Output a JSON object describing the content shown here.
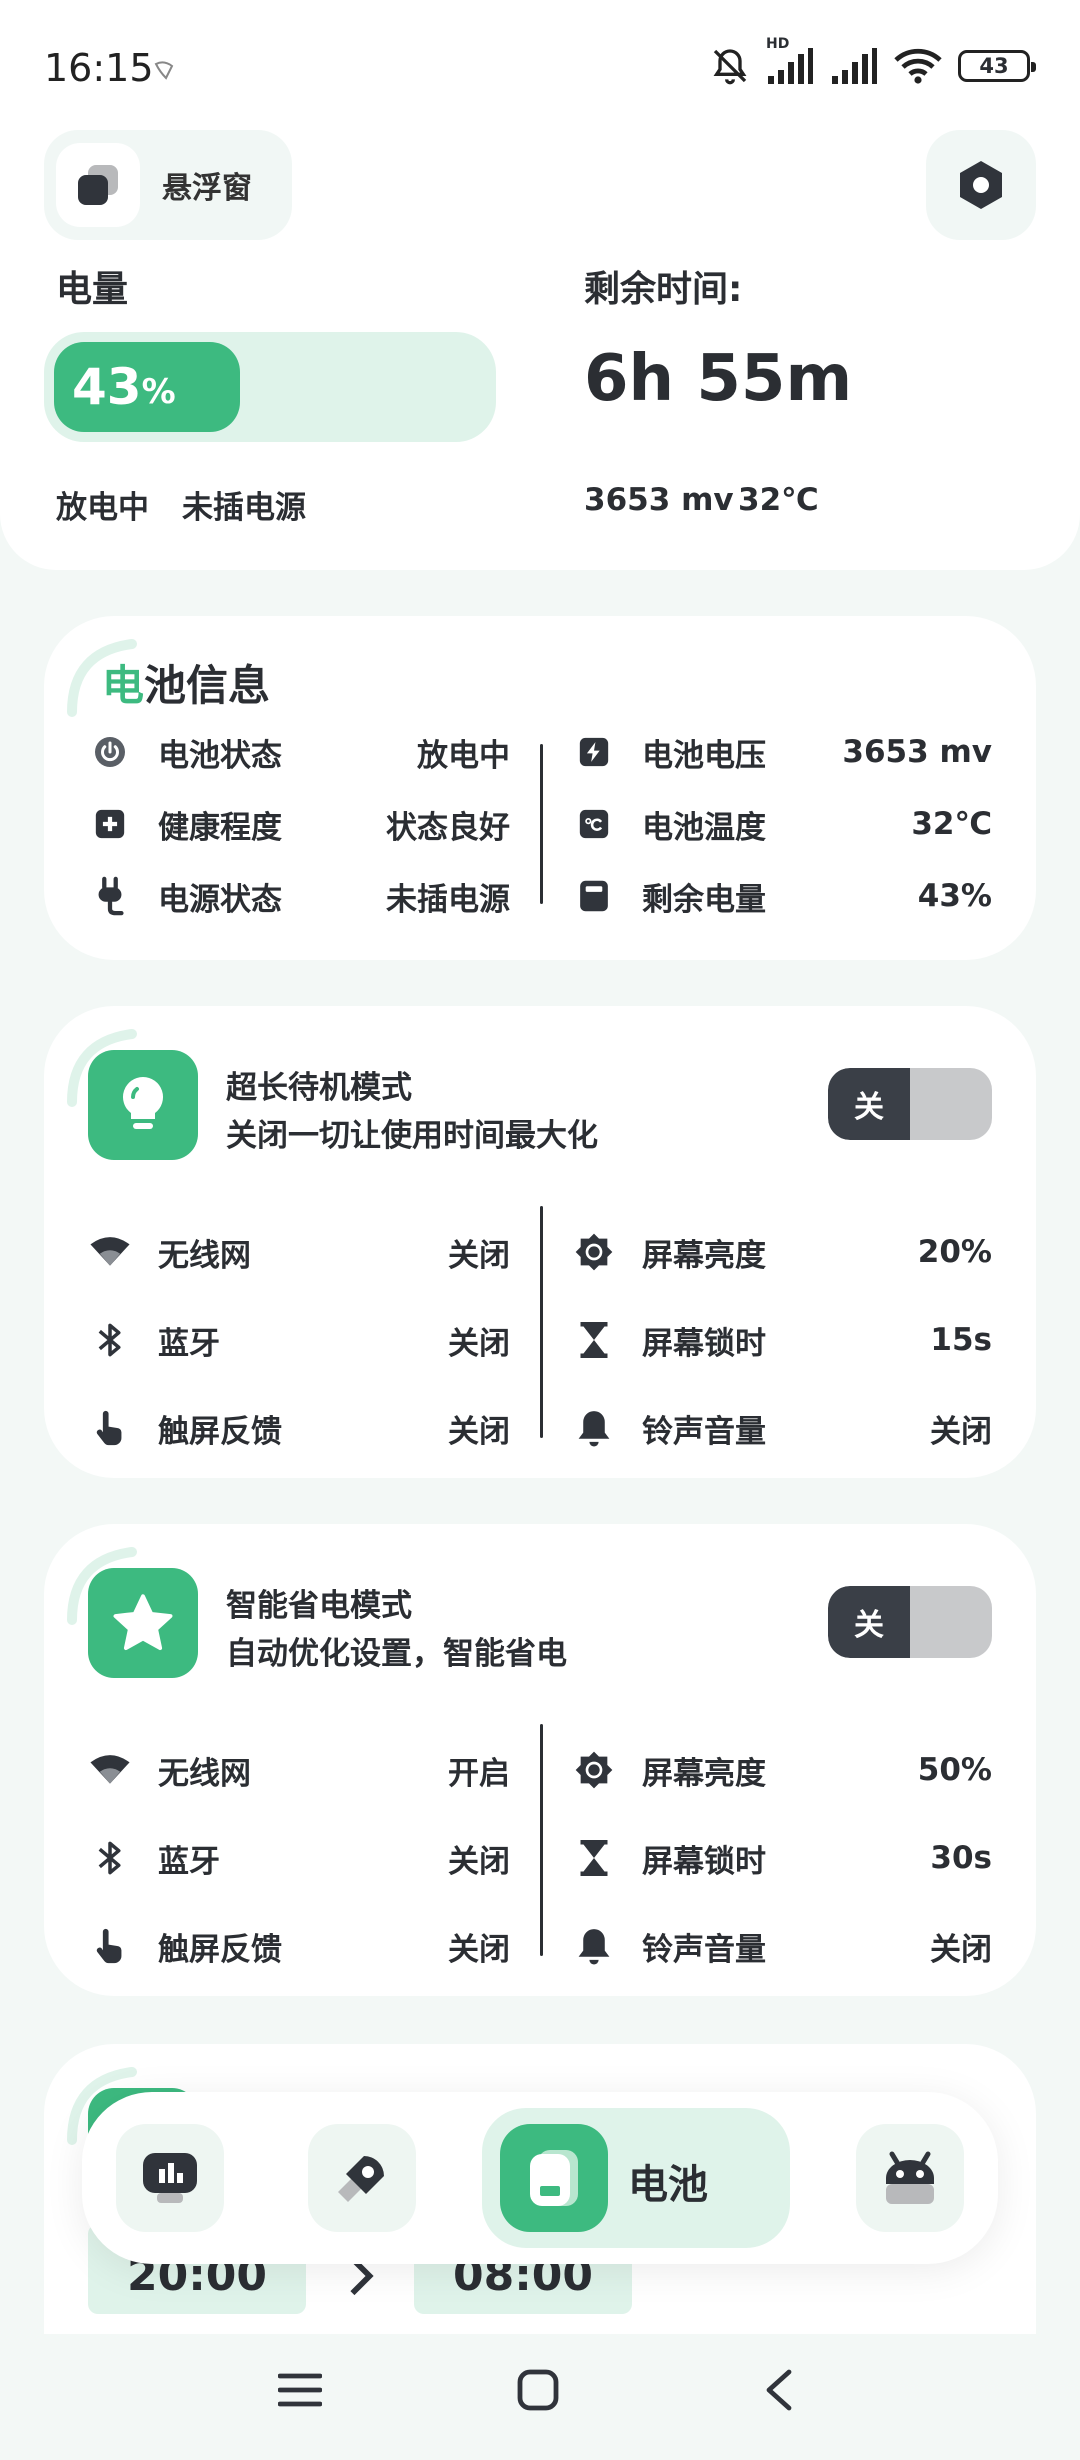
{
  "status_bar": {
    "time": "16:15",
    "battery_level": "43",
    "network_badge": "HD",
    "icons": [
      "bell-off-icon",
      "signal-hd-icon",
      "signal-icon",
      "wifi-icon",
      "battery-icon"
    ]
  },
  "header": {
    "float_window_label": "悬浮窗",
    "power_label": "电量",
    "battery_percent": "43",
    "battery_percent_unit": "%",
    "battery_level_fraction": 0.43,
    "remaining_time_label": "剩余时间:",
    "remaining_time": "6h 55m",
    "charge_state": "放电中",
    "power_source": "未插电源",
    "voltage": "3653 mv",
    "temperature": "32℃"
  },
  "battery_info": {
    "title_accent": "电",
    "title_rest": "池信息",
    "left": [
      {
        "icon": "power-icon",
        "label": "电池状态",
        "value": "放电中"
      },
      {
        "icon": "health-plus-icon",
        "label": "健康程度",
        "value": "状态良好"
      },
      {
        "icon": "plug-icon",
        "label": "电源状态",
        "value": "未插电源"
      }
    ],
    "right": [
      {
        "icon": "bolt-icon",
        "label": "电池电压",
        "value": "3653 mv"
      },
      {
        "icon": "thermometer-icon",
        "label": "电池温度",
        "value": "32℃"
      },
      {
        "icon": "battery-box-icon",
        "label": "剩余电量",
        "value": "43%"
      }
    ]
  },
  "ultra_standby": {
    "title": "超长待机模式",
    "description": "关闭一切让使用时间最大化",
    "toggle_label": "关",
    "left": [
      {
        "icon": "wifi-icon",
        "label": "无线网",
        "value": "关闭"
      },
      {
        "icon": "bluetooth-icon",
        "label": "蓝牙",
        "value": "关闭"
      },
      {
        "icon": "touch-icon",
        "label": "触屏反馈",
        "value": "关闭"
      }
    ],
    "right": [
      {
        "icon": "brightness-icon",
        "label": "屏幕亮度",
        "value": "20%"
      },
      {
        "icon": "hourglass-icon",
        "label": "屏幕锁时",
        "value": "15s"
      },
      {
        "icon": "bell-icon",
        "label": "铃声音量",
        "value": "关闭"
      }
    ]
  },
  "smart_saving": {
    "title": "智能省电模式",
    "description": "自动优化设置，智能省电",
    "toggle_label": "关",
    "left": [
      {
        "icon": "wifi-icon",
        "label": "无线网",
        "value": "开启"
      },
      {
        "icon": "bluetooth-icon",
        "label": "蓝牙",
        "value": "关闭"
      },
      {
        "icon": "touch-icon",
        "label": "触屏反馈",
        "value": "关闭"
      }
    ],
    "right": [
      {
        "icon": "brightness-icon",
        "label": "屏幕亮度",
        "value": "50%"
      },
      {
        "icon": "hourglass-icon",
        "label": "屏幕锁时",
        "value": "30s"
      },
      {
        "icon": "bell-icon",
        "label": "铃声音量",
        "value": "关闭"
      }
    ]
  },
  "schedule": {
    "start_time": "20:00",
    "end_time": "08:00"
  },
  "bottom_nav": {
    "active_label": "电池",
    "items": [
      "monitor-icon",
      "rocket-icon",
      "battery-icon",
      "android-robot-icon"
    ]
  },
  "colors": {
    "accent": "#3dba80",
    "accent_light": "#dff3ea",
    "text": "#2b2e33",
    "background": "#f3f8f6"
  }
}
